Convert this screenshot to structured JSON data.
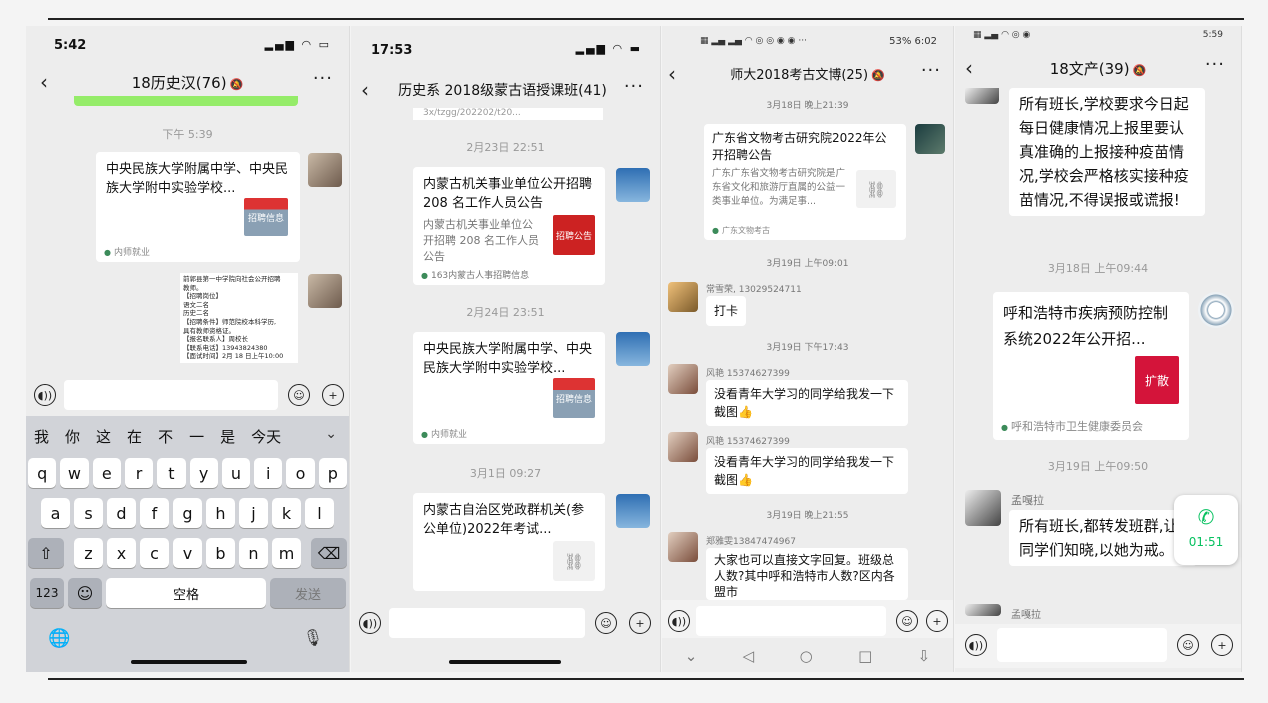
{
  "accent": "#07c160",
  "panel1": {
    "time": "5:42",
    "title": "18历史汉(76)",
    "timestamp": "下午 5:39",
    "card1": {
      "title": "中央民族大学附属中学、中央民族大学附中实验学校...",
      "thumb": "招聘信息",
      "source": "内师就业"
    },
    "card2_lines": [
      "前郭县第一中学院向社会公开招聘",
      "教师。",
      "【招聘岗位】",
      "语文二名",
      "历史二名",
      "【招聘条件】师范院校本科学历,",
      "具有教师资格证。",
      "【报名联系人】周校长",
      "【联系电话】13943824380",
      "【面试时间】2月 18 日上午10:00"
    ],
    "candidates": [
      "我",
      "你",
      "这",
      "在",
      "不",
      "一",
      "是",
      "今天"
    ],
    "row1": [
      "q",
      "w",
      "e",
      "r",
      "t",
      "y",
      "u",
      "i",
      "o",
      "p"
    ],
    "row2": [
      "a",
      "s",
      "d",
      "f",
      "g",
      "h",
      "j",
      "k",
      "l"
    ],
    "row3": [
      "z",
      "x",
      "c",
      "v",
      "b",
      "n",
      "m"
    ],
    "k123": "123",
    "space": "空格",
    "send": "发送"
  },
  "panel2": {
    "time": "17:53",
    "title": "历史系 2018级蒙古语授课班(41)",
    "partial_top": "3x/tzgg/202202/t20...",
    "ts1": "2月23日 22:51",
    "card1": {
      "title": "内蒙古机关事业单位公开招聘 208 名工作人员公告",
      "desc": "内蒙古机关事业单位公开招聘 208 名工作人员公告",
      "thumb": "招聘公告",
      "source": "163内蒙古人事招聘信息"
    },
    "ts2": "2月24日 23:51",
    "card2": {
      "title": "中央民族大学附属中学、中央民族大学附中实验学校...",
      "thumb": "招聘信息",
      "source": "内师就业"
    },
    "ts3": "3月1日 09:27",
    "card3": {
      "title": "内蒙古自治区党政群机关(参公单位)2022年考试..."
    }
  },
  "panel3": {
    "status": "53% 6:02",
    "title": "师大2018考古文博(25)",
    "ts1": "3月18日 晚上21:39",
    "card1": {
      "title": "广东省文物考古研究院2022年公开招聘公告",
      "desc": "广东广东省文物考古研究院是广东省文化和旅游厅直属的公益一类事业单位。为满足事...",
      "source": "广东文物考古"
    },
    "ts2": "3月19日 上午09:01",
    "nick1": "常雪荣, 13029524711",
    "msg1": "打卡",
    "ts3": "3月19日 下午17:43",
    "nick2": "风艳 15374627399",
    "msg2": "没看青年大学习的同学给我发一下截图👍",
    "nick3": "风艳 15374627399",
    "msg3": "没看青年大学习的同学给我发一下截图👍",
    "ts4": "3月19日 晚上21:55",
    "nick4": "郑雅雯13847474967",
    "msg4": "大家也可以直接文字回复。班级总人数?其中呼和浩特市人数?区内各盟市"
  },
  "panel4": {
    "status": "5:59",
    "title": "18文产(39)",
    "msg1": "所有班长,学校要求今日起每日健康情况上报里要认真准确的上报接种疫苗情况,学校会严格核实接种疫苗情况,不得误报或谎报!",
    "ts1": "3月18日 上午09:44",
    "card": {
      "title": "呼和浩特市疾病预防控制系统2022年公开招...",
      "thumb": "扩散",
      "source": "呼和浩特市卫生健康委员会"
    },
    "ts2": "3月19日 上午09:50",
    "nick1": "孟嘎拉",
    "msg2": "所有班长,都转发班群,让同学们知晓,以她为戒。",
    "nick2": "孟嘎拉",
    "call_duration": "01:51"
  }
}
